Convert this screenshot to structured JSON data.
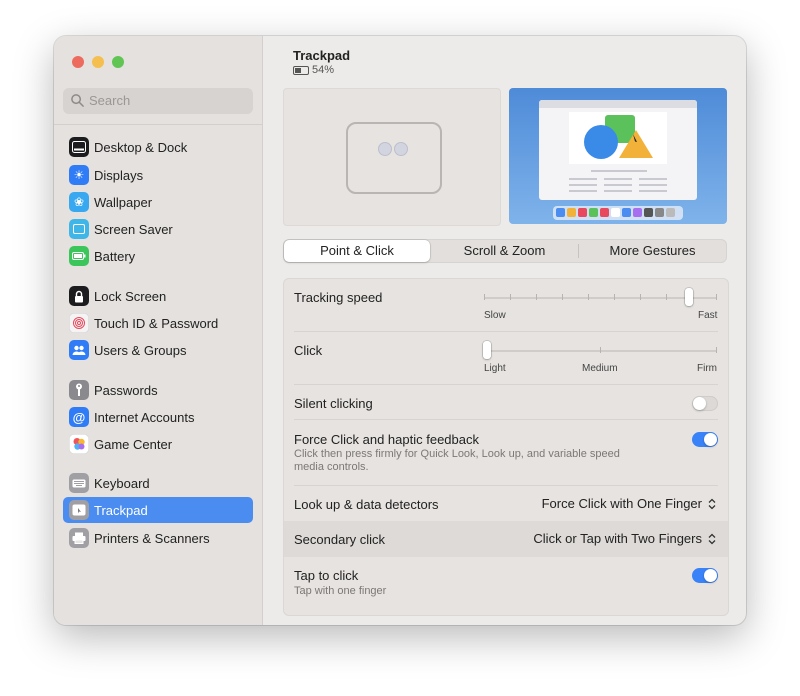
{
  "search": {
    "placeholder": "Search"
  },
  "sidebar": {
    "items": [
      {
        "label": "Desktop & Dock",
        "icon": "dock-icon",
        "color": "#1c1c1e"
      },
      {
        "label": "Displays",
        "icon": "sun-icon",
        "color": "#2f7cf6"
      },
      {
        "label": "Wallpaper",
        "icon": "flower-icon",
        "color": "#38a8f0"
      },
      {
        "label": "Screen Saver",
        "icon": "screen-saver-icon",
        "color": "#3fb6e8"
      },
      {
        "label": "Battery",
        "icon": "battery-icon",
        "color": "#3cc55a"
      },
      {
        "label": "Lock Screen",
        "icon": "lock-icon",
        "color": "#1c1c1e"
      },
      {
        "label": "Touch ID & Password",
        "icon": "fingerprint-icon",
        "color": "#f4f4f4"
      },
      {
        "label": "Users & Groups",
        "icon": "users-icon",
        "color": "#2f7cf6"
      },
      {
        "label": "Passwords",
        "icon": "key-icon",
        "color": "#8a8a8e"
      },
      {
        "label": "Internet Accounts",
        "icon": "at-icon",
        "color": "#2f7cf6"
      },
      {
        "label": "Game Center",
        "icon": "game-center-icon",
        "color": "#ffffff"
      },
      {
        "label": "Keyboard",
        "icon": "keyboard-icon",
        "color": "#a0a0a4"
      },
      {
        "label": "Trackpad",
        "icon": "trackpad-icon",
        "color": "#a0a0a4"
      },
      {
        "label": "Printers & Scanners",
        "icon": "printer-icon",
        "color": "#a0a0a4"
      }
    ]
  },
  "header": {
    "title": "Trackpad",
    "battery": "54%"
  },
  "tabs": [
    {
      "label": "Point & Click",
      "selected": true
    },
    {
      "label": "Scroll & Zoom",
      "selected": false
    },
    {
      "label": "More Gestures",
      "selected": false
    }
  ],
  "settings": {
    "tracking_speed": {
      "label": "Tracking speed",
      "min_label": "Slow",
      "max_label": "Fast",
      "value_fraction": 0.88
    },
    "click": {
      "label": "Click",
      "left_label": "Light",
      "mid_label": "Medium",
      "right_label": "Firm",
      "value_fraction": 0.0
    },
    "silent_clicking": {
      "label": "Silent clicking",
      "on": false
    },
    "force_click": {
      "label": "Force Click and haptic feedback",
      "desc": "Click then press firmly for Quick Look, Look up, and variable speed media controls.",
      "on": true
    },
    "look_up": {
      "label": "Look up & data detectors",
      "value": "Force Click with One Finger"
    },
    "secondary_click": {
      "label": "Secondary click",
      "value": "Click or Tap with Two Fingers"
    },
    "tap_to_click": {
      "label": "Tap to click",
      "desc": "Tap with one finger",
      "on": true
    }
  },
  "colors": {
    "accent": "#3a82f7",
    "selection": "#4a8cf0"
  }
}
